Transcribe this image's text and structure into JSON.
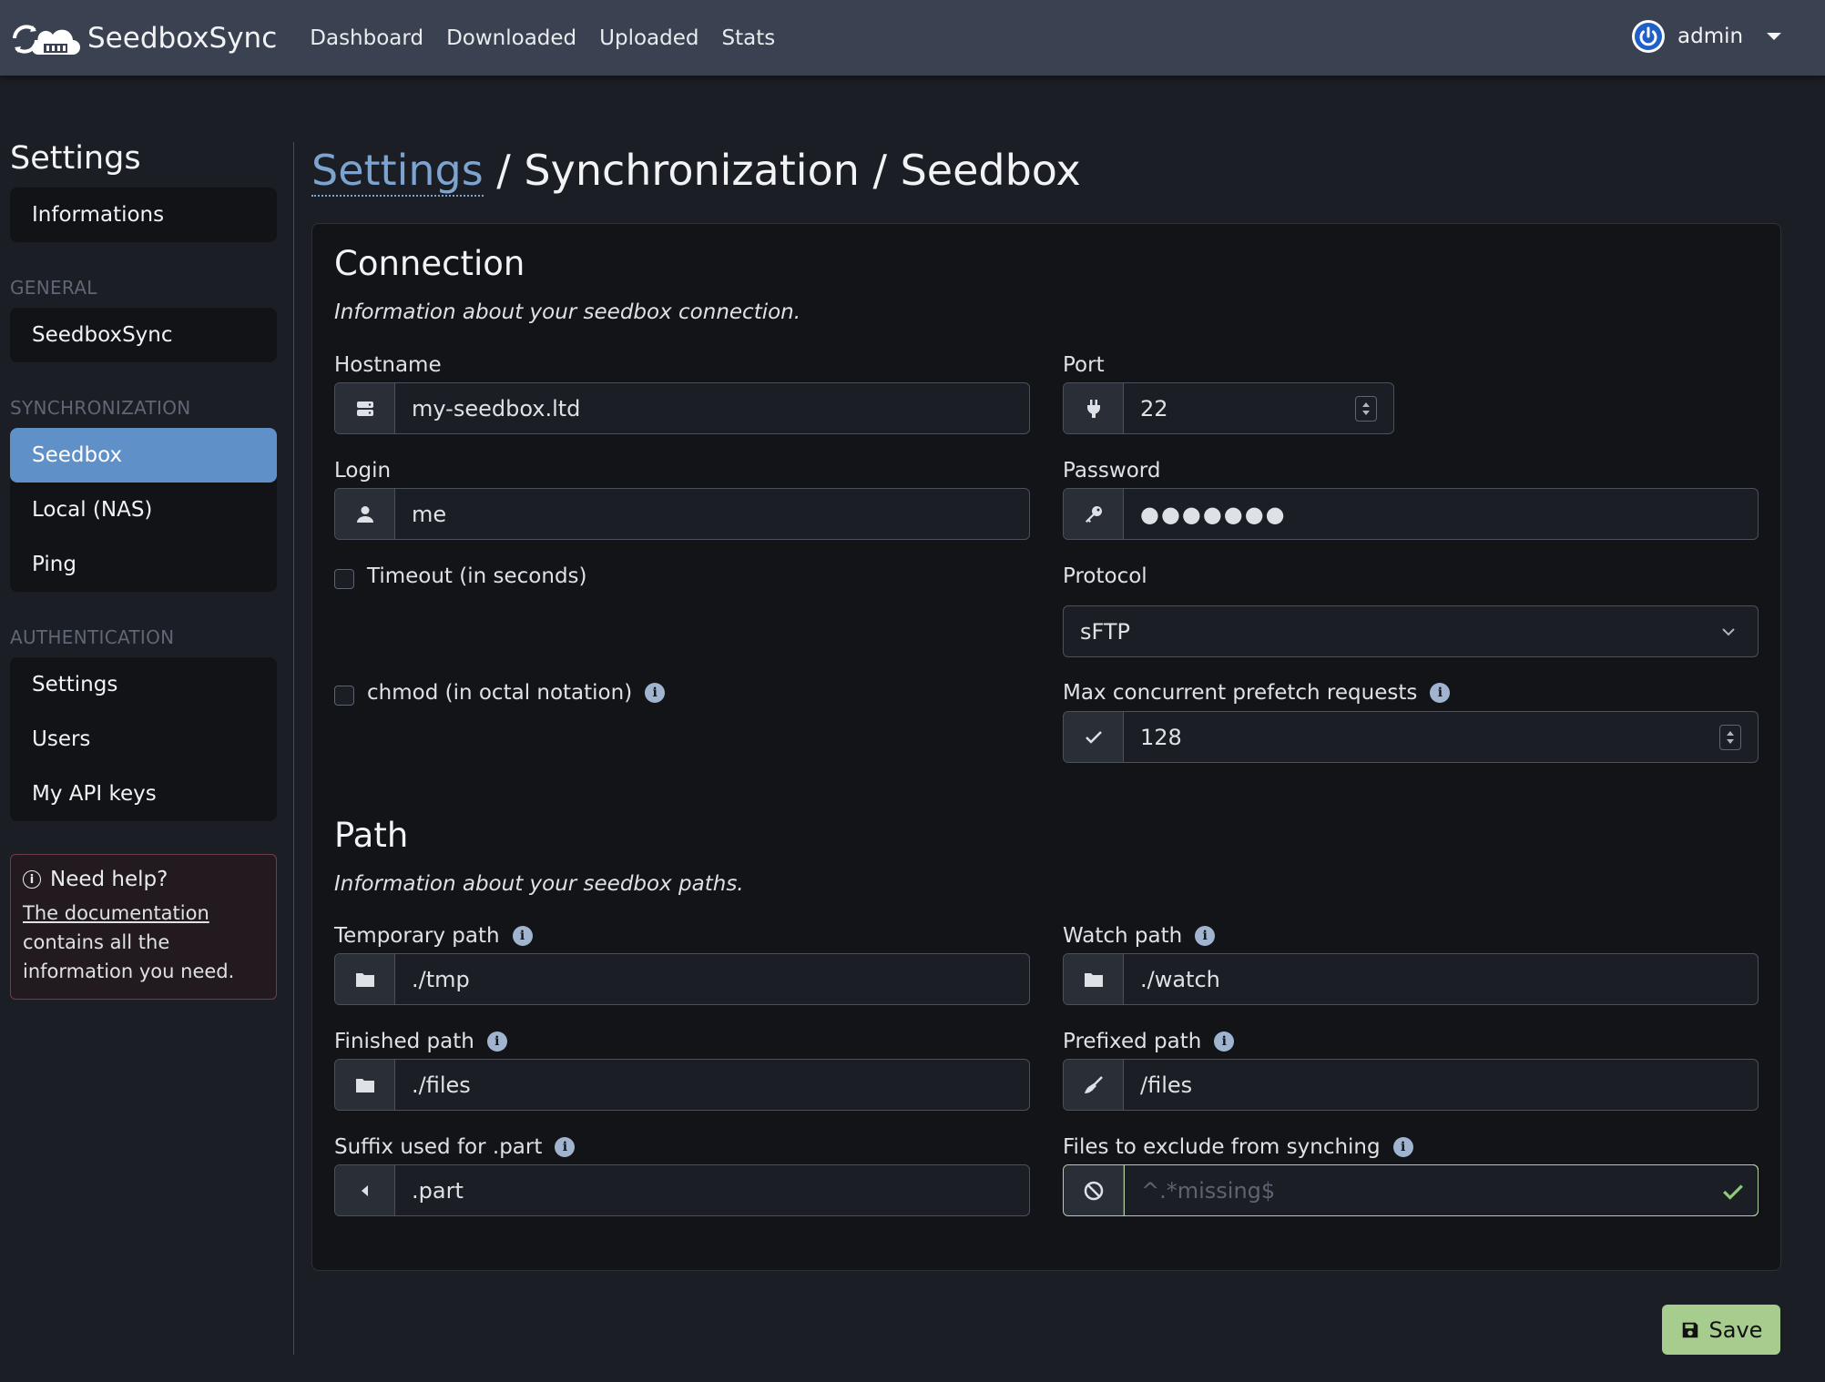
{
  "navbar": {
    "brand": "SeedboxSync",
    "links": [
      "Dashboard",
      "Downloaded",
      "Uploaded",
      "Stats"
    ],
    "user": "admin"
  },
  "sidebar": {
    "title": "Settings",
    "informations": "Informations",
    "sections": [
      {
        "label": "GENERAL",
        "items": [
          "SeedboxSync"
        ]
      },
      {
        "label": "SYNCHRONIZATION",
        "items": [
          "Seedbox",
          "Local (NAS)",
          "Ping"
        ]
      },
      {
        "label": "AUTHENTICATION",
        "items": [
          "Settings",
          "Users",
          "My API keys"
        ]
      }
    ],
    "active": "Seedbox",
    "help": {
      "title": "Need help?",
      "link": "The documentation",
      "text": "contains all the information you need."
    }
  },
  "breadcrumb": {
    "link": "Settings",
    "rest": " / Synchronization / Seedbox"
  },
  "connection": {
    "title": "Connection",
    "description": "Information about your seedbox connection.",
    "hostname": {
      "label": "Hostname",
      "value": "my-seedbox.ltd"
    },
    "port": {
      "label": "Port",
      "value": "22"
    },
    "login": {
      "label": "Login",
      "value": "me"
    },
    "password": {
      "label": "Password",
      "value": "●●●●●●●"
    },
    "timeout": {
      "label": "Timeout (in seconds)"
    },
    "protocol": {
      "label": "Protocol",
      "value": "sFTP"
    },
    "chmod": {
      "label": "chmod (in octal notation)"
    },
    "prefetch": {
      "label": "Max concurrent prefetch requests",
      "value": "128"
    }
  },
  "path": {
    "title": "Path",
    "description": "Information about your seedbox paths.",
    "temporary": {
      "label": "Temporary path",
      "value": "./tmp"
    },
    "watch": {
      "label": "Watch path",
      "value": "./watch"
    },
    "finished": {
      "label": "Finished path",
      "value": "./files"
    },
    "prefixed": {
      "label": "Prefixed path",
      "value": "/files"
    },
    "suffix": {
      "label": "Suffix used for .part",
      "value": ".part"
    },
    "exclude": {
      "label": "Files to exclude from synching",
      "placeholder": "^.*missing$"
    }
  },
  "actions": {
    "save": "Save"
  },
  "colors": {
    "active": "#6090c8",
    "save": "#a6cc8e",
    "navbar": "#3a4150"
  }
}
